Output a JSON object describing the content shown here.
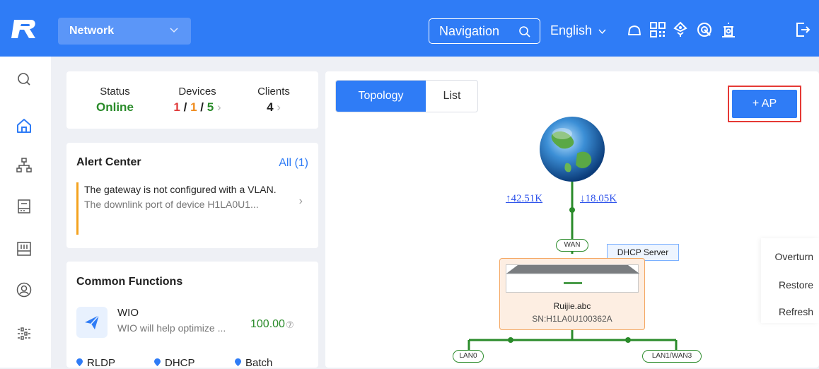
{
  "header": {
    "module": "Network",
    "navigation_label": "Navigation",
    "language": "English",
    "icons": [
      "cloud-icon",
      "qr-code-icon",
      "network-rocket-icon",
      "settings-gear-icon",
      "bell-alert-icon",
      "logout-icon"
    ]
  },
  "sidebar": {
    "icons": [
      "search-icon",
      "home-icon",
      "topology-icon",
      "router-icon",
      "switch-icon",
      "user-icon",
      "settings-sliders-icon"
    ]
  },
  "status": {
    "status_label": "Status",
    "status_value": "Online",
    "devices_label": "Devices",
    "devices_a": "1",
    "devices_sep1": "/",
    "devices_b": "1",
    "devices_sep2": "/",
    "devices_c": "5",
    "clients_label": "Clients",
    "clients_value": "4",
    "chevron": "›"
  },
  "alert": {
    "title": "Alert Center",
    "all_label": "All (1)",
    "line1": "The gateway is not configured with a VLAN.",
    "line2": "The downlink port of device H1LA0U1...",
    "arrow": "›"
  },
  "functions": {
    "title": "Common Functions",
    "wio_title": "WIO",
    "wio_desc": "WIO will help optimize ...",
    "wio_score": "100.00",
    "wio_help": "⑦",
    "chips": [
      "RLDP",
      "DHCP",
      "Batch"
    ]
  },
  "topology": {
    "tab_active": "Topology",
    "tab_other": "List",
    "add_ap": "+ AP",
    "upload": "↑42.51K",
    "download": "↓18.05K",
    "wan_label": "WAN",
    "dhcp_label": "DHCP Server",
    "device_name": "Ruijie.abc",
    "device_sn": "SN:H1LA0U100362A",
    "lan0": "LAN0",
    "lan1": "LAN1/WAN3",
    "actions": [
      "Overturn",
      "Restore",
      "Refresh"
    ]
  },
  "colors": {
    "primary": "#2f7cf6",
    "online": "#2a8b2a",
    "alert_red": "#e03b3b",
    "alert_orange": "#f08c1e",
    "link_green": "#2a8b2a"
  }
}
